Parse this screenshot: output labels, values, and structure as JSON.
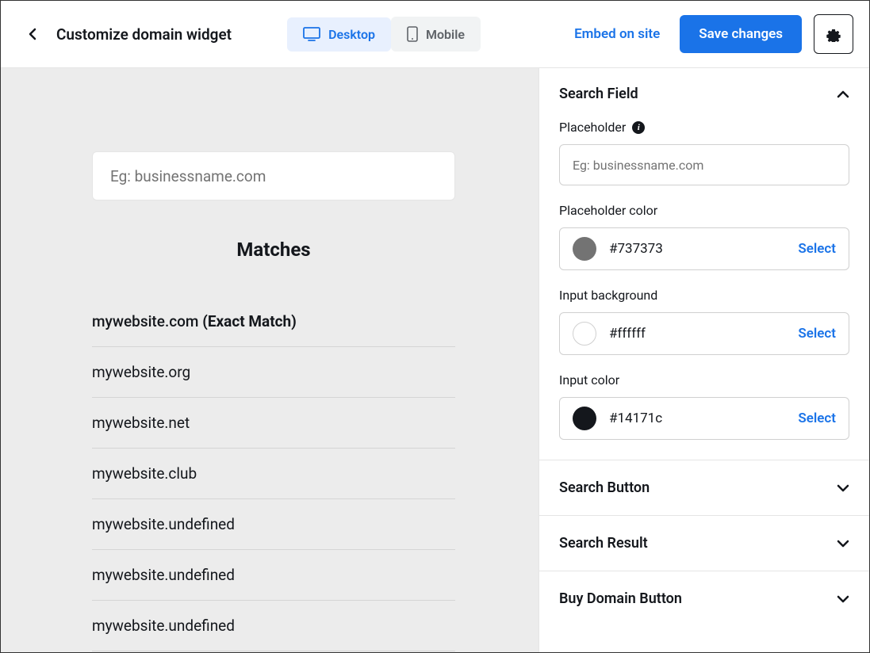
{
  "header": {
    "title": "Customize domain widget",
    "desktop_label": "Desktop",
    "mobile_label": "Mobile",
    "embed_label": "Embed on site",
    "save_label": "Save changes"
  },
  "preview": {
    "placeholder": "Eg: businessname.com",
    "matches_title": "Matches",
    "rows": [
      {
        "domain": "mywebsite.com",
        "exact": "(Exact Match)"
      },
      {
        "domain": "mywebsite.org",
        "exact": ""
      },
      {
        "domain": "mywebsite.net",
        "exact": ""
      },
      {
        "domain": "mywebsite.club",
        "exact": ""
      },
      {
        "domain": "mywebsite.undefined",
        "exact": ""
      },
      {
        "domain": "mywebsite.undefined",
        "exact": ""
      },
      {
        "domain": "mywebsite.undefined",
        "exact": ""
      }
    ]
  },
  "sidebar": {
    "search_field": {
      "title": "Search Field",
      "placeholder_label": "Placeholder",
      "placeholder_value": "Eg: businessname.com",
      "placeholder_color_label": "Placeholder color",
      "placeholder_color_value": "#737373",
      "input_bg_label": "Input background",
      "input_bg_value": "#ffffff",
      "input_color_label": "Input color",
      "input_color_value": "#14171c",
      "select_label": "Select"
    },
    "sections": {
      "search_button": "Search Button",
      "search_result": "Search Result",
      "buy_domain": "Buy Domain Button"
    }
  }
}
